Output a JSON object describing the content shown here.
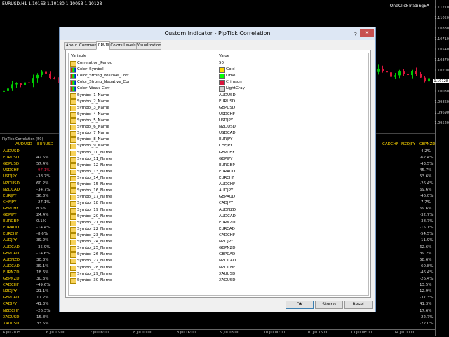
{
  "chart": {
    "title": "EURUSD,H1 1.10163 1.10180 1.10053 1.10128",
    "ea_label": "OneClickTradingEA",
    "price_labels": [
      "1.11210",
      "1.11050",
      "1.10880",
      "1.10710",
      "1.10540",
      "1.10370",
      "1.10200",
      "1.10128",
      "1.10030",
      "1.09860",
      "1.09690",
      "1.09520"
    ],
    "current_price": "1.10128"
  },
  "indicator": {
    "title": "PipTick Correlation (50)",
    "header_visible": [
      "AUDUSD",
      "EURUSD",
      "CADCHF",
      "NZDJPY",
      "GBPNZD"
    ],
    "row_symbols": [
      "AUDUSD",
      "EURUSD",
      "GBPUSD",
      "USDCHF",
      "USDJPY",
      "NZDUSD",
      "NZDCAD",
      "EURJPY",
      "CHFJPY",
      "GBPCHF",
      "GBPJPY",
      "EURGBP",
      "EURAUD",
      "EURCHF",
      "AUDJPY",
      "AUDCAD",
      "GBPCAD",
      "AUDNZD",
      "AUDCAD",
      "EURNZD",
      "GBPNZD",
      "CADCHF",
      "NZDJPY",
      "GBPCAD",
      "CADJPY",
      "NZDCHF",
      "XAGUSD",
      "XAUUSD"
    ],
    "left_col_values": [
      "",
      "42.5%",
      "57.4%",
      "-97.1%",
      "-38.7%",
      "60.2%",
      "-34.7%",
      "36.3%",
      "-27.1%",
      "8.5%",
      "24.4%",
      "0.1%",
      "-14.4%",
      "-8.6%",
      "39.2%",
      "-35.9%",
      "-14.6%",
      "30.3%",
      "39.1%",
      "18.6%",
      "30.3%",
      "-49.6%",
      "21.1%",
      "17.2%",
      "41.3%",
      "-26.3%",
      "15.8%",
      "33.5%"
    ],
    "right_col_values": [
      "-4.2%",
      "-62.4%",
      "-43.5%",
      "45.7%",
      "53.6%",
      "-26.4%",
      "69.6%",
      "-46.0%",
      "-7.7%",
      "69.6%",
      "-32.7%",
      "-38.7%",
      "-15.1%",
      "-54.5%",
      "-11.9%",
      "62.6%",
      "39.2%",
      "58.6%",
      "-60.8%",
      "-46.4%",
      "-26.4%",
      "13.5%",
      "12.9%",
      "-37.3%",
      "41.3%",
      "17.6%",
      "-22.7%",
      "-22.0%"
    ],
    "time_labels": [
      "6 Jul 2015",
      "6 Jul 16:00",
      "7 Jul 08:00",
      "8 Jul 00:00",
      "8 Jul 16:00",
      "9 Jul 08:00",
      "10 Jul 00:00",
      "10 Jul 16:00",
      "13 Jul 08:00",
      "14 Jul 00:00"
    ]
  },
  "dialog": {
    "title": "Custom Indicator - PipTick Correlation",
    "help": "?",
    "close": "✕",
    "tabs": [
      "About",
      "Common",
      "Inputs",
      "Colors",
      "Levels",
      "Visualization"
    ],
    "active_tab": "Inputs",
    "col_variable": "Variable",
    "col_value": "Value",
    "rows": [
      {
        "name": "Correlation_Period",
        "value": "50",
        "icon": "ab"
      },
      {
        "name": "Color_Symbol",
        "value": "Gold",
        "icon": "color",
        "swatch": "#ffd700"
      },
      {
        "name": "Color_Strong_Positive_Corr",
        "value": "Lime",
        "icon": "color",
        "swatch": "#00ff00"
      },
      {
        "name": "Color_Strong_Negative_Corr",
        "value": "Crimson",
        "icon": "color",
        "swatch": "#dc143c"
      },
      {
        "name": "Color_Weak_Corr",
        "value": "LightGray",
        "icon": "color",
        "swatch": "#d3d3d3"
      },
      {
        "name": "Symbol_1_Name",
        "value": "AUDUSD",
        "icon": "ab"
      },
      {
        "name": "Symbol_2_Name",
        "value": "EURUSD",
        "icon": "ab"
      },
      {
        "name": "Symbol_3_Name",
        "value": "GBPUSD",
        "icon": "ab"
      },
      {
        "name": "Symbol_4_Name",
        "value": "USDCHF",
        "icon": "ab"
      },
      {
        "name": "Symbol_5_Name",
        "value": "USDJPY",
        "icon": "ab"
      },
      {
        "name": "Symbol_6_Name",
        "value": "NZDUSD",
        "icon": "ab"
      },
      {
        "name": "Symbol_7_Name",
        "value": "USDCAD",
        "icon": "ab"
      },
      {
        "name": "Symbol_8_Name",
        "value": "EURJPY",
        "icon": "ab"
      },
      {
        "name": "Symbol_9_Name",
        "value": "CHFJPY",
        "icon": "ab"
      },
      {
        "name": "Symbol_10_Name",
        "value": "GBPCHF",
        "icon": "ab"
      },
      {
        "name": "Symbol_11_Name",
        "value": "GBPJPY",
        "icon": "ab"
      },
      {
        "name": "Symbol_12_Name",
        "value": "EURGBP",
        "icon": "ab"
      },
      {
        "name": "Symbol_13_Name",
        "value": "EURAUD",
        "icon": "ab"
      },
      {
        "name": "Symbol_14_Name",
        "value": "EURCHF",
        "icon": "ab"
      },
      {
        "name": "Symbol_15_Name",
        "value": "AUDCHF",
        "icon": "ab"
      },
      {
        "name": "Symbol_16_Name",
        "value": "AUDJPY",
        "icon": "ab"
      },
      {
        "name": "Symbol_17_Name",
        "value": "GBPAUD",
        "icon": "ab"
      },
      {
        "name": "Symbol_18_Name",
        "value": "CADJPY",
        "icon": "ab"
      },
      {
        "name": "Symbol_19_Name",
        "value": "AUDNZD",
        "icon": "ab"
      },
      {
        "name": "Symbol_20_Name",
        "value": "AUDCAD",
        "icon": "ab"
      },
      {
        "name": "Symbol_21_Name",
        "value": "EURNZD",
        "icon": "ab"
      },
      {
        "name": "Symbol_22_Name",
        "value": "EURCAD",
        "icon": "ab"
      },
      {
        "name": "Symbol_23_Name",
        "value": "CADCHF",
        "icon": "ab"
      },
      {
        "name": "Symbol_24_Name",
        "value": "NZDJPY",
        "icon": "ab"
      },
      {
        "name": "Symbol_25_Name",
        "value": "GBPNZD",
        "icon": "ab"
      },
      {
        "name": "Symbol_26_Name",
        "value": "GBPCAD",
        "icon": "ab"
      },
      {
        "name": "Symbol_27_Name",
        "value": "NZDCAD",
        "icon": "ab"
      },
      {
        "name": "Symbol_28_Name",
        "value": "NZDCHF",
        "icon": "ab"
      },
      {
        "name": "Symbol_29_Name",
        "value": "XAUUSD",
        "icon": "ab"
      },
      {
        "name": "Symbol_30_Name",
        "value": "XAGUSD",
        "icon": "ab"
      }
    ],
    "buttons": {
      "ok": "OK",
      "cancel": "Storno",
      "reset": "Reset"
    }
  },
  "colors": {
    "gold": "#ffd700",
    "lime": "#00ff00",
    "crimson": "#dc143c",
    "gray": "#d3d3d3"
  }
}
